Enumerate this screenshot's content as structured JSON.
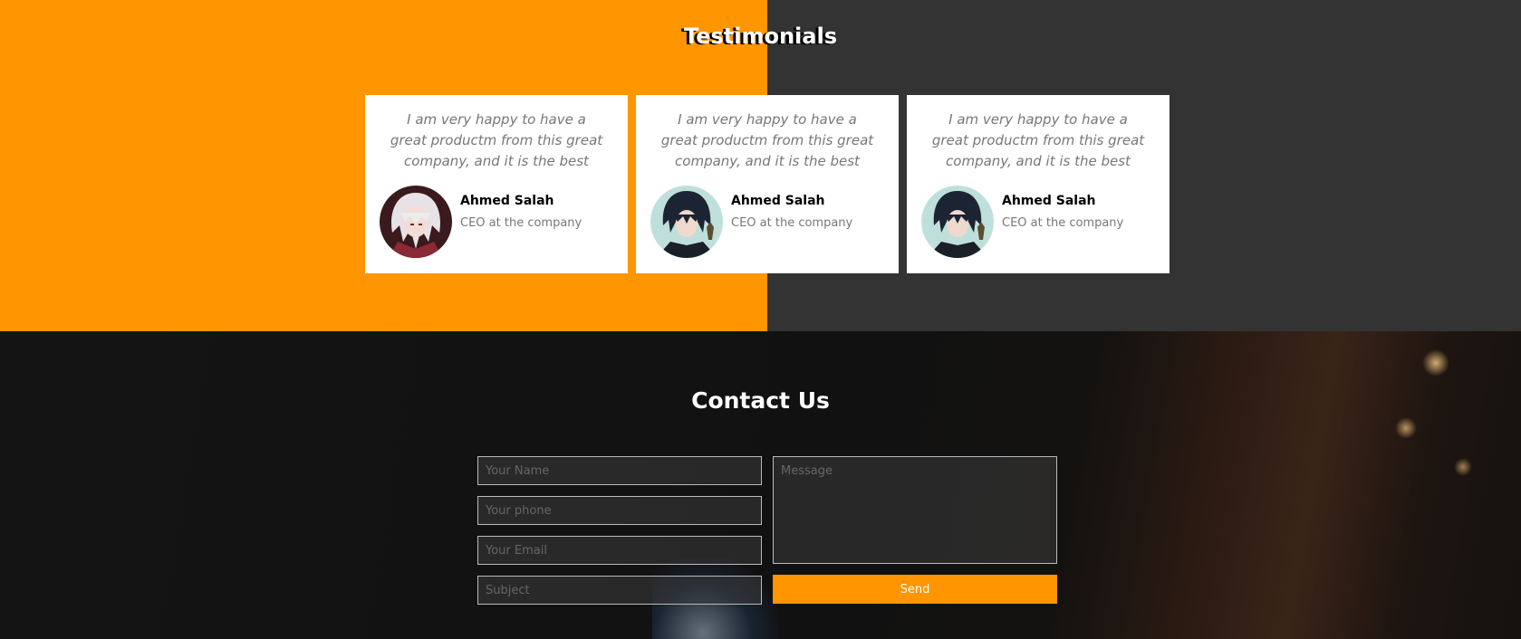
{
  "testimonials": {
    "title": "Testimonials",
    "items": [
      {
        "quote": "I am very happy to have a great productm from this great company, and it is the best",
        "name": "Ahmed Salah",
        "role": "CEO at the company",
        "avatar": "white-hair-anime-avatar"
      },
      {
        "quote": "I am very happy to have a great productm from this great company, and it is the best",
        "name": "Ahmed Salah",
        "role": "CEO at the company",
        "avatar": "dark-hair-anime-avatar"
      },
      {
        "quote": "I am very happy to have a great productm from this great company, and it is the best",
        "name": "Ahmed Salah",
        "role": "CEO at the company",
        "avatar": "dark-hair-anime-avatar"
      }
    ]
  },
  "contact": {
    "title": "Contact Us",
    "name_placeholder": "Your Name",
    "phone_placeholder": "Your phone",
    "email_placeholder": "Your Email",
    "subject_placeholder": "Subject",
    "message_placeholder": "Message",
    "send_label": "Send"
  },
  "colors": {
    "accent": "#ff9500",
    "dark": "#333333"
  }
}
